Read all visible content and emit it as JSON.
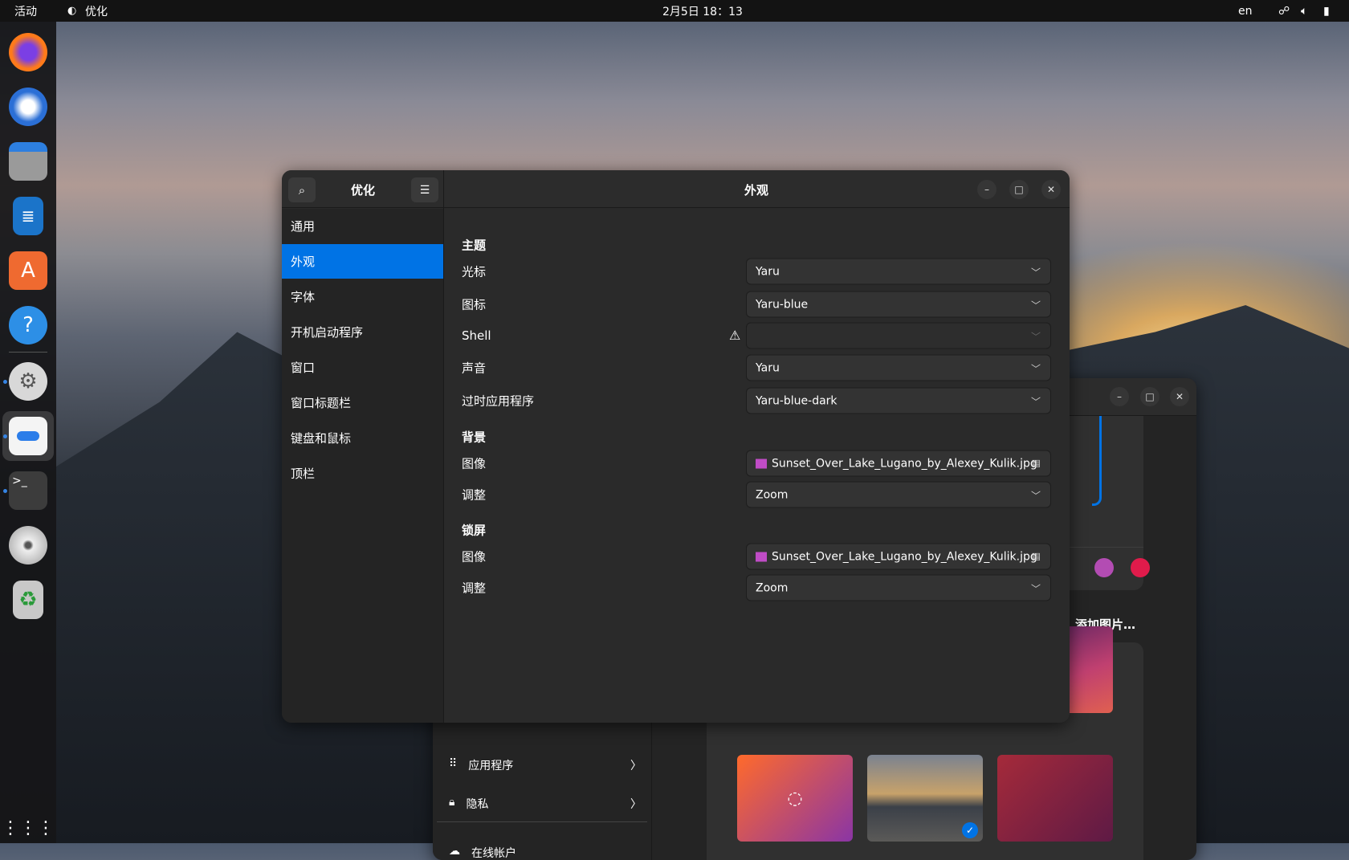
{
  "topbar": {
    "activities": "活动",
    "app_name": "优化",
    "clock": "2月5日  18：13",
    "lang": "en",
    "icons": [
      "network-icon",
      "volume-icon",
      "battery-icon"
    ]
  },
  "dock": {
    "items": [
      "firefox",
      "thunderbird",
      "files",
      "libreoffice-writer",
      "app-center",
      "help",
      "settings",
      "tweaks",
      "terminal",
      "disc",
      "trash"
    ],
    "show_apps": "show-apps-icon"
  },
  "tweaks": {
    "title": "优化",
    "page_title": "外观",
    "sidebar": [
      "通用",
      "外观",
      "字体",
      "开机启动程序",
      "窗口",
      "窗口标题栏",
      "键盘和鼠标",
      "顶栏"
    ],
    "selected": 1,
    "sections": {
      "theme": "主题",
      "background": "背景",
      "lockscreen": "锁屏"
    },
    "rows": {
      "cursor": {
        "label": "光标",
        "value": "Yaru"
      },
      "icons": {
        "label": "图标",
        "value": "Yaru-blue"
      },
      "shell": {
        "label": "Shell",
        "value": ""
      },
      "sound": {
        "label": "声音",
        "value": "Yaru"
      },
      "legacy": {
        "label": "过时应用程序",
        "value": "Yaru-blue-dark"
      },
      "bg_image": {
        "label": "图像",
        "value": "Sunset_Over_Lake_Lugano_by_Alexey_Kulik.jpg"
      },
      "bg_adjust": {
        "label": "调整",
        "value": "Zoom"
      },
      "ls_image": {
        "label": "图像",
        "value": "Sunset_Over_Lake_Lugano_by_Alexey_Kulik.jpg"
      },
      "ls_adjust": {
        "label": "调整",
        "value": "Zoom"
      }
    }
  },
  "settings": {
    "sidebar": [
      "应用程序",
      "隐私",
      "在线帐户"
    ],
    "add_picture": "添加图片…",
    "accent_colors": [
      "#b34cb3",
      "#e01b4b"
    ],
    "accent": "#0073e5"
  }
}
